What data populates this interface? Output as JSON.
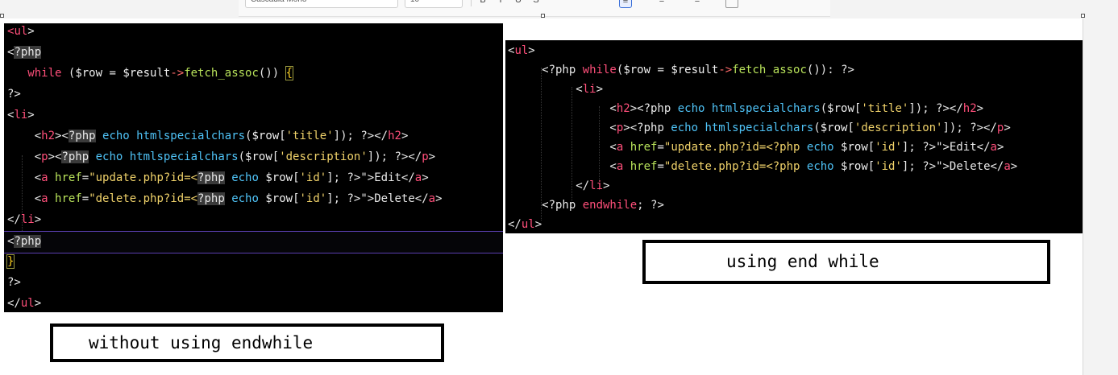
{
  "toolbar": {
    "font_name": "Cascadia Mono",
    "font_size": "10"
  },
  "left_panel": {
    "lines": [
      [
        [
          "tag",
          "<"
        ],
        [
          "tag",
          "ul"
        ],
        [
          "br",
          ">"
        ]
      ],
      [
        [
          "br",
          "<"
        ],
        [
          "phpbg",
          "?php"
        ]
      ],
      [
        [
          "plain",
          "   "
        ],
        [
          "kw",
          "while"
        ],
        [
          "plain",
          " ("
        ],
        [
          "var",
          "$row"
        ],
        [
          "plain",
          " = "
        ],
        [
          "var",
          "$result"
        ],
        [
          "op",
          "->"
        ],
        [
          "fn",
          "fetch_assoc"
        ],
        [
          "plain",
          "()) "
        ],
        [
          "curly",
          "{"
        ]
      ],
      [
        [
          "br",
          "?>"
        ]
      ],
      [
        [
          "br",
          "<"
        ],
        [
          "tag",
          "li"
        ],
        [
          "br",
          ">"
        ]
      ],
      [
        [
          "plain",
          "    <"
        ],
        [
          "tag",
          "h2"
        ],
        [
          "br",
          "><"
        ],
        [
          "phpbg",
          "?php"
        ],
        [
          "fn2",
          " echo htmlspecialchars"
        ],
        [
          "plain",
          "("
        ],
        [
          "var",
          "$row"
        ],
        [
          "plain",
          "["
        ],
        [
          "str",
          "'title'"
        ],
        [
          "plain",
          "]); ?></"
        ],
        [
          "tag",
          "h2"
        ],
        [
          "br",
          ">"
        ]
      ],
      [
        [
          "plain",
          "    <"
        ],
        [
          "tag",
          "p"
        ],
        [
          "br",
          "><"
        ],
        [
          "phpbg",
          "?php"
        ],
        [
          "fn2",
          " echo htmlspecialchars"
        ],
        [
          "plain",
          "("
        ],
        [
          "var",
          "$row"
        ],
        [
          "plain",
          "["
        ],
        [
          "str",
          "'description'"
        ],
        [
          "plain",
          "]); ?></"
        ],
        [
          "tag",
          "p"
        ],
        [
          "br",
          ">"
        ]
      ],
      [
        [
          "plain",
          "    <"
        ],
        [
          "tag",
          "a"
        ],
        [
          "attr",
          " href"
        ],
        [
          "plain",
          "="
        ],
        [
          "str",
          "\"update.php?id=<"
        ],
        [
          "phpbg",
          "?php"
        ],
        [
          "fn2",
          " echo "
        ],
        [
          "var",
          "$row"
        ],
        [
          "plain",
          "["
        ],
        [
          "str",
          "'id'"
        ],
        [
          "plain",
          "]; ?>\">Edit</"
        ],
        [
          "tag",
          "a"
        ],
        [
          "br",
          ">"
        ]
      ],
      [
        [
          "plain",
          "    <"
        ],
        [
          "tag",
          "a"
        ],
        [
          "attr",
          " href"
        ],
        [
          "plain",
          "="
        ],
        [
          "str",
          "\"delete.php?id=<"
        ],
        [
          "phpbg",
          "?php"
        ],
        [
          "fn2",
          " echo "
        ],
        [
          "var",
          "$row"
        ],
        [
          "plain",
          "["
        ],
        [
          "str",
          "'id'"
        ],
        [
          "plain",
          "]; ?>\">Delete</"
        ],
        [
          "tag",
          "a"
        ],
        [
          "br",
          ">"
        ]
      ],
      [
        [
          "br",
          "</"
        ],
        [
          "tag",
          "li"
        ],
        [
          "br",
          ">"
        ]
      ],
      [
        [
          "br",
          "<"
        ],
        [
          "phpbg",
          "?php"
        ]
      ],
      [
        [
          "curly",
          "}"
        ]
      ],
      [
        [
          "br",
          "?>"
        ]
      ],
      [
        [
          "br",
          "</"
        ],
        [
          "tag",
          "ul"
        ],
        [
          "br",
          ">"
        ]
      ]
    ]
  },
  "right_panel": {
    "lines": [
      [
        [
          "br",
          "<"
        ],
        [
          "tag",
          "ul"
        ],
        [
          "br",
          ">"
        ]
      ],
      [
        [
          "plain",
          "     <?php "
        ],
        [
          "kw",
          "while"
        ],
        [
          "plain",
          "("
        ],
        [
          "var",
          "$row"
        ],
        [
          "plain",
          " = "
        ],
        [
          "var",
          "$result"
        ],
        [
          "op",
          "->"
        ],
        [
          "fn",
          "fetch_assoc"
        ],
        [
          "plain",
          "()): ?>"
        ]
      ],
      [
        [
          "plain",
          "          <"
        ],
        [
          "tag",
          "li"
        ],
        [
          "br",
          ">"
        ]
      ],
      [
        [
          "plain",
          "               <"
        ],
        [
          "tag",
          "h2"
        ],
        [
          "br",
          "><?php"
        ],
        [
          "fn2",
          " echo htmlspecialchars"
        ],
        [
          "plain",
          "("
        ],
        [
          "var",
          "$row"
        ],
        [
          "plain",
          "["
        ],
        [
          "str",
          "'title'"
        ],
        [
          "plain",
          "]); ?></"
        ],
        [
          "tag",
          "h2"
        ],
        [
          "br",
          ">"
        ]
      ],
      [
        [
          "plain",
          "               <"
        ],
        [
          "tag",
          "p"
        ],
        [
          "br",
          "><?php"
        ],
        [
          "fn2",
          " echo htmlspecialchars"
        ],
        [
          "plain",
          "("
        ],
        [
          "var",
          "$row"
        ],
        [
          "plain",
          "["
        ],
        [
          "str",
          "'description'"
        ],
        [
          "plain",
          "]); ?></"
        ],
        [
          "tag",
          "p"
        ],
        [
          "br",
          ">"
        ]
      ],
      [
        [
          "plain",
          "               <"
        ],
        [
          "tag",
          "a"
        ],
        [
          "attr",
          " href"
        ],
        [
          "plain",
          "="
        ],
        [
          "str",
          "\"update.php?id=<?php"
        ],
        [
          "fn2",
          " echo "
        ],
        [
          "var",
          "$row"
        ],
        [
          "plain",
          "["
        ],
        [
          "str",
          "'id'"
        ],
        [
          "plain",
          "]; ?>\">Edit</"
        ],
        [
          "tag",
          "a"
        ],
        [
          "br",
          ">"
        ]
      ],
      [
        [
          "plain",
          "               <"
        ],
        [
          "tag",
          "a"
        ],
        [
          "attr",
          " href"
        ],
        [
          "plain",
          "="
        ],
        [
          "str",
          "\"delete.php?id=<?php"
        ],
        [
          "fn2",
          " echo "
        ],
        [
          "var",
          "$row"
        ],
        [
          "plain",
          "["
        ],
        [
          "str",
          "'id'"
        ],
        [
          "plain",
          "]; ?>\">Delete</"
        ],
        [
          "tag",
          "a"
        ],
        [
          "br",
          ">"
        ]
      ],
      [
        [
          "plain",
          "          </"
        ],
        [
          "tag",
          "li"
        ],
        [
          "br",
          ">"
        ]
      ],
      [
        [
          "plain",
          "     <?php "
        ],
        [
          "kw",
          "endwhile"
        ],
        [
          "plain",
          "; ?>"
        ]
      ],
      [
        [
          "br",
          "</"
        ],
        [
          "tag",
          "ul"
        ],
        [
          "br",
          ">"
        ]
      ]
    ]
  },
  "captions": {
    "left": "without using endwhile",
    "right": "using end while"
  }
}
